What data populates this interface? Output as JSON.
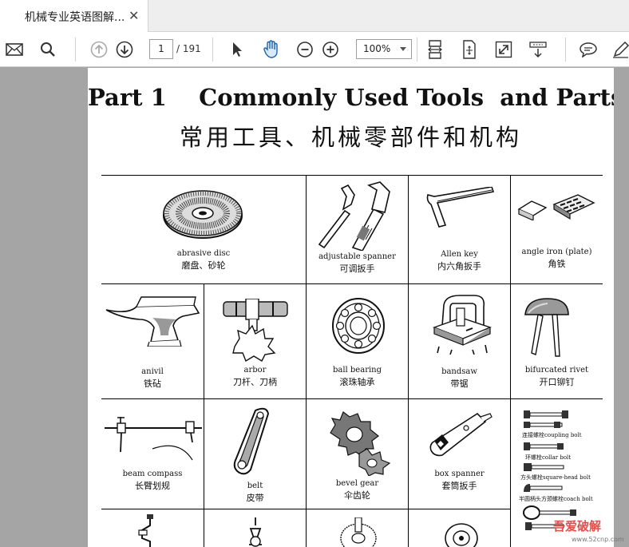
{
  "tab": {
    "title": "机械专业英语图解...",
    "close": "✕"
  },
  "toolbar": {
    "page_current": "1",
    "page_total": "/ 191",
    "zoom": "100%"
  },
  "page": {
    "title_en": "Part 1    Commonly Used Tools  and Parts",
    "title_cn": "常用工具、机械零部件和机构"
  },
  "items": [
    {
      "en": "abrasive disc",
      "cn": "磨盘、砂轮"
    },
    {
      "en": "adjustable spanner",
      "cn": "可调扳手"
    },
    {
      "en": "Allen key",
      "cn": "内六角扳手"
    },
    {
      "en": "angle iron (plate)",
      "cn": "角铁"
    },
    {
      "en": "anivil",
      "cn": "铁砧"
    },
    {
      "en": "arbor",
      "cn": "刀杆、刀柄"
    },
    {
      "en": "ball bearing",
      "cn": "滚珠轴承"
    },
    {
      "en": "bandsaw",
      "cn": "带锯"
    },
    {
      "en": "bifurcated rivet",
      "cn": "开口铆钉"
    },
    {
      "en": "beam compass",
      "cn": "长臂划规"
    },
    {
      "en": "belt",
      "cn": "皮带"
    },
    {
      "en": "bevel gear",
      "cn": "伞齿轮"
    },
    {
      "en": "box spanner",
      "cn": "套筒扳手"
    }
  ],
  "bolts": [
    "连接螺栓coupling bolt",
    "环螺栓collar bolt",
    "方头螺栓square-head bolt",
    "半圆柄头方颈螺栓coach bolt"
  ],
  "watermark": {
    "text": "吾爱破解",
    "url": "www.52cnp.com"
  }
}
